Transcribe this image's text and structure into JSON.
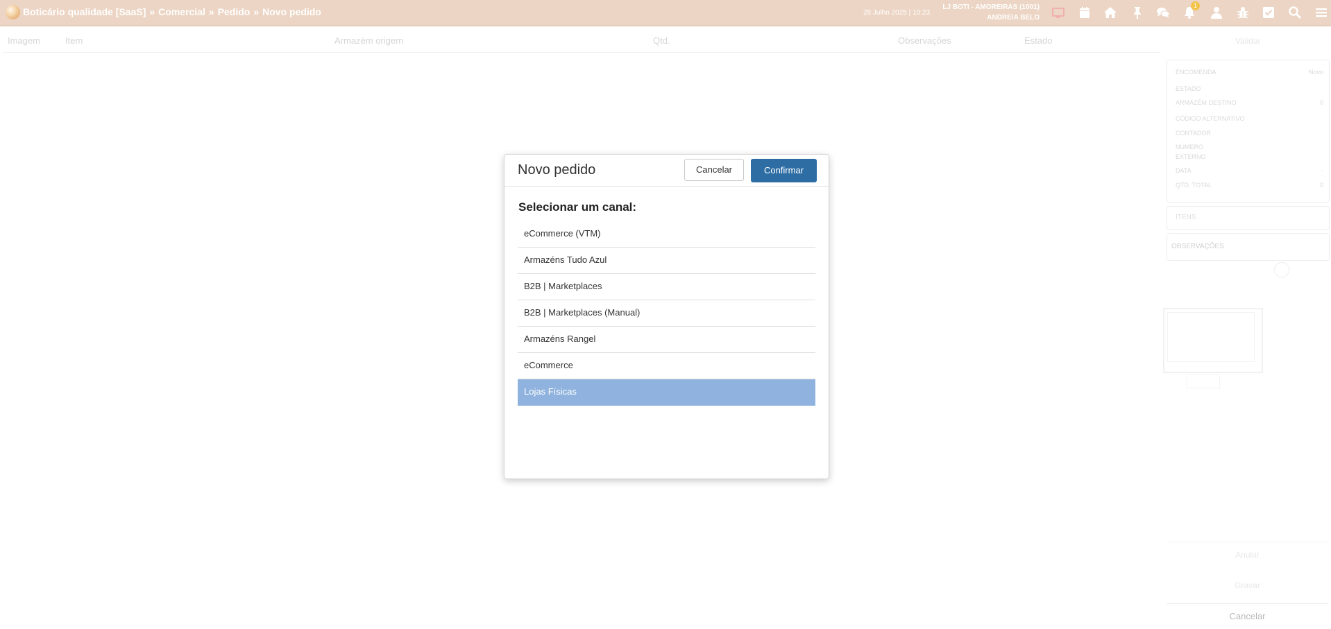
{
  "topbar": {
    "breadcrumb": [
      "Boticário qualidade [SaaS]",
      "Comercial",
      "Pedido",
      "Novo pedido"
    ],
    "breadcrumb_separator": "»",
    "datetime": "28 Julho 2025 | 10:23",
    "store": "LJ BOTI - AMOREIRAS (1001)",
    "user": "ANDREIA BELO",
    "notification_count": "1",
    "icons": [
      "screen-icon",
      "calendar-icon",
      "home-icon",
      "pin-icon",
      "chat-icon",
      "bell-icon",
      "user-icon",
      "bug-icon",
      "check-square-icon",
      "search-icon",
      "menu-icon"
    ]
  },
  "table": {
    "headers": [
      "Imagem",
      "Item",
      "Armazém origem",
      "Qtd.",
      "Observações",
      "Estado"
    ]
  },
  "side_panel": {
    "top_button": "Validar",
    "summary": {
      "encomenda_label": "ENCOMENDA",
      "encomenda_value": "Novo",
      "estado_label": "ESTADO",
      "armazem_label": "ARMAZÉM DESTINO",
      "armazem_value": "0",
      "codigo_label": "CÓDIGO ALTERNATIVO",
      "contador_label": "CONTADOR",
      "numero_label_1": "NÚMERO",
      "numero_label_2": "EXTERNO",
      "data_label": "DATA",
      "data_value": "-",
      "qtd_label": "QTD. TOTAL",
      "qtd_value": "0"
    },
    "items_title": "ITENS",
    "obs_title": "OBSERVAÇÕES",
    "annul_button": "Anular",
    "save_button": "Gravar",
    "cancel_button": "Cancelar"
  },
  "modal": {
    "title": "Novo pedido",
    "cancel_label": "Cancelar",
    "confirm_label": "Confirmar",
    "subtitle": "Selecionar um canal:",
    "channels": [
      "eCommerce (VTM)",
      "Armazéns Tudo Azul",
      "B2B | Marketplaces",
      "B2B | Marketplaces (Manual)",
      "Armazéns Rangel",
      "eCommerce",
      "Lojas Físicas"
    ],
    "selected_channel": "Lojas Físicas"
  },
  "colors": {
    "topbar_bg": "#ecd5c4",
    "confirm_bg": "#2e6da4",
    "selected_bg": "#8fb3de"
  }
}
